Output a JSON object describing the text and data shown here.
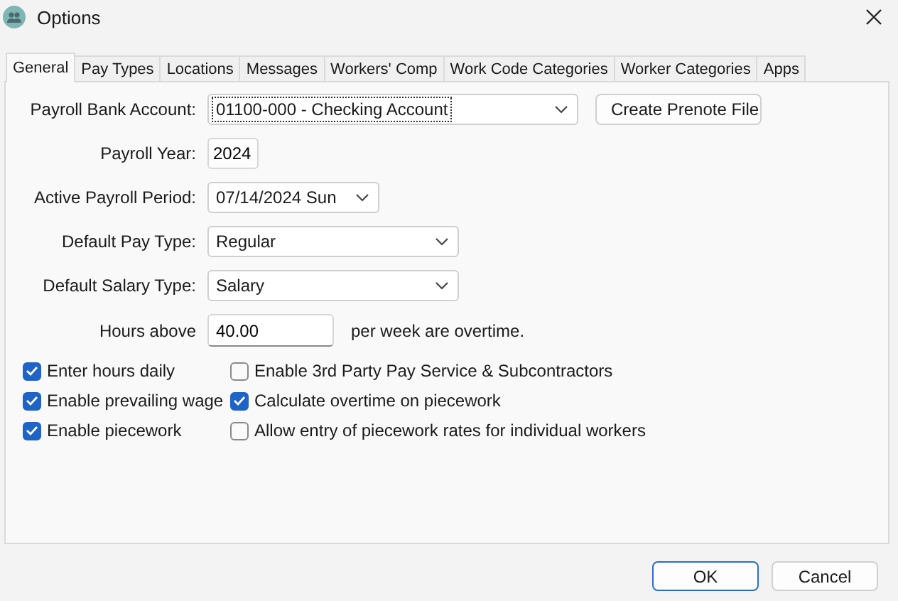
{
  "window": {
    "title": "Options"
  },
  "tabs": [
    {
      "label": "General",
      "selected": true
    },
    {
      "label": "Pay Types",
      "selected": false
    },
    {
      "label": "Locations",
      "selected": false
    },
    {
      "label": "Messages",
      "selected": false
    },
    {
      "label": "Workers' Comp",
      "selected": false
    },
    {
      "label": "Work Code Categories",
      "selected": false
    },
    {
      "label": "Worker Categories",
      "selected": false
    },
    {
      "label": "Apps",
      "selected": false
    }
  ],
  "fields": [
    {
      "label": "Payroll Bank Account:",
      "kind": "dropdown",
      "value": "01100-000 - Checking Account",
      "focused": true,
      "button": "Create Prenote File"
    },
    {
      "label": "Payroll Year:",
      "kind": "spin",
      "value": "2024"
    },
    {
      "label": "Active Payroll Period:",
      "kind": "dropdown",
      "value": "07/14/2024 Sun",
      "focused": false
    },
    {
      "label": "Default Pay Type:",
      "kind": "dropdown",
      "value": "Regular",
      "focused": false
    },
    {
      "label": "Default Salary Type:",
      "kind": "dropdown",
      "value": "Salary",
      "focused": false
    },
    {
      "label": "Hours above",
      "kind": "text",
      "value": "40.00",
      "suffix": "per week are overtime."
    }
  ],
  "options": [
    {
      "label": "Enter hours daily",
      "checked": true
    },
    {
      "label": "Enable 3rd Party Pay Service & Subcontractors",
      "checked": false
    },
    {
      "label": "Enable prevailing wage",
      "checked": true
    },
    {
      "label": "Calculate overtime on piecework",
      "checked": true
    },
    {
      "label": "Enable piecework",
      "checked": true
    },
    {
      "label": "Allow entry of piecework rates for individual workers",
      "checked": false
    }
  ],
  "buttons": [
    {
      "label": "OK",
      "default": true
    },
    {
      "label": "Cancel",
      "default": false
    }
  ]
}
